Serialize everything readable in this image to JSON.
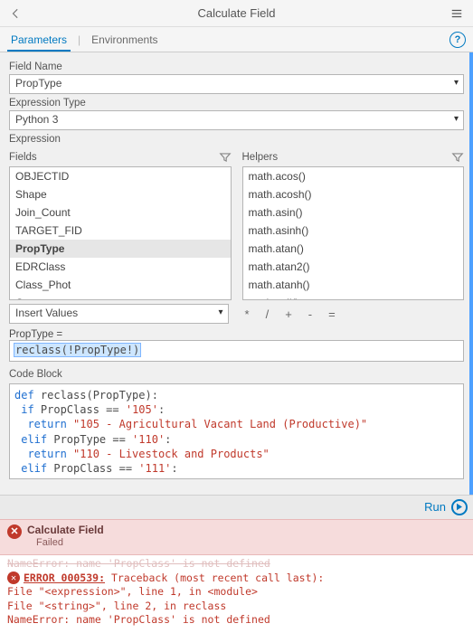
{
  "titlebar": {
    "title": "Calculate Field"
  },
  "tabs": {
    "parameters": "Parameters",
    "environments": "Environments"
  },
  "form": {
    "field_name_label": "Field Name",
    "field_name_value": "PropType",
    "expr_type_label": "Expression Type",
    "expr_type_value": "Python 3",
    "expression_label": "Expression",
    "fields_label": "Fields",
    "helpers_label": "Helpers",
    "fields": [
      "OBJECTID",
      "Shape",
      "Join_Count",
      "TARGET_FID",
      "PropType",
      "EDRClass",
      "Class_Phot",
      "Comments"
    ],
    "fields_selected": "PropType",
    "helpers": [
      "math.acos()",
      "math.acosh()",
      "math.asin()",
      "math.asinh()",
      "math.atan()",
      "math.atan2()",
      "math.atanh()",
      "math.ceil()"
    ],
    "insert_values": "Insert Values",
    "ops": [
      "*",
      "/",
      "+",
      "-",
      "="
    ],
    "eq_label": "PropType =",
    "expression_code": "reclass(!PropType!)",
    "code_block_label": "Code Block",
    "code_block": {
      "l1_a": "def",
      "l1_b": " reclass(PropType):",
      "l2_a": " if",
      "l2_b": " PropClass == ",
      "l2_c": "'105'",
      "l2_d": ":",
      "l3_a": "  return ",
      "l3_b": "\"105 - Agricultural Vacant Land (Productive)\"",
      "l4_a": " elif",
      "l4_b": " PropType == ",
      "l4_c": "'110'",
      "l4_d": ":",
      "l5_a": "  return ",
      "l5_b": "\"110 - Livestock and Products\"",
      "l6_a": " elif",
      "l6_b": " PropClass == ",
      "l6_c": "'111'",
      "l6_d": ":"
    }
  },
  "run": {
    "label": "Run"
  },
  "error_banner": {
    "title": "Calculate Field",
    "status": "Failed"
  },
  "error_details": {
    "prev": "NameError: name 'PropClass' is not defined",
    "code": "ERROR 000539:",
    "trace1": " Traceback (most recent call last):",
    "trace2": "  File \"<expression>\", line 1, in <module>",
    "trace3": "  File \"<string>\", line 2, in reclass",
    "trace4": "NameError: name 'PropClass' is not defined"
  }
}
